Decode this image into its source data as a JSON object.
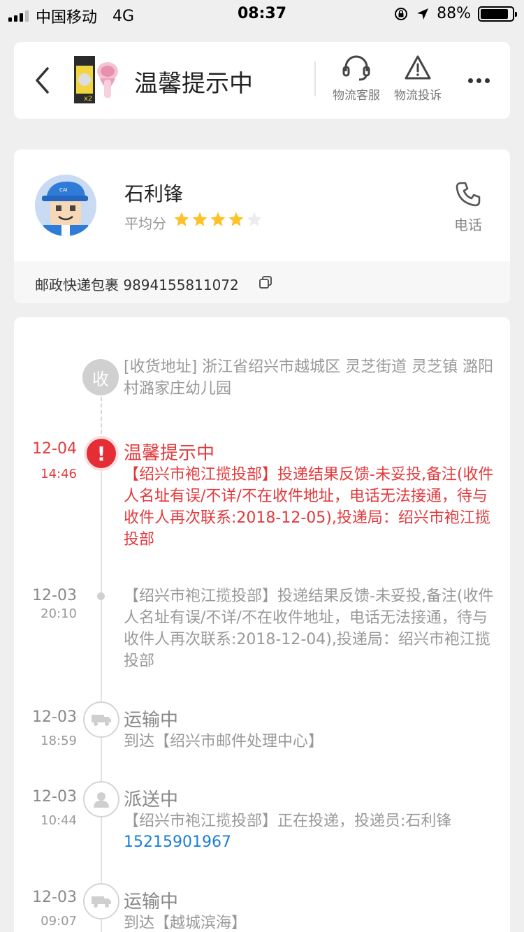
{
  "status_bar": {
    "carrier": "中国移动",
    "network": "4G",
    "time": "08:37",
    "battery": "88%"
  },
  "header": {
    "title": "温馨提示中",
    "service_label": "物流客服",
    "complaint_label": "物流投诉"
  },
  "courier": {
    "name": "石利锋",
    "rating_label": "平均分",
    "rating": 4,
    "rating_max": 5,
    "phone_label": "电话",
    "package_label": "邮政快递包裹 9894155811072"
  },
  "timeline": {
    "address": {
      "badge": "收",
      "text": "[收货地址] 浙江省绍兴市越城区  灵芝街道   灵芝镇 潞阳村潞家庄幼儿园"
    },
    "events": [
      {
        "date": "12-04",
        "time": "14:46",
        "title": "温馨提示中",
        "body": "【绍兴市袍江揽投部】投递结果反馈-未妥投,备注(收件人名址有误/不详/不在收件地址，电话无法接通，待与收件人再次联系:2018-12-05),投递局：绍兴市袍江揽投部"
      },
      {
        "date": "12-03",
        "time": "20:10",
        "body": "【绍兴市袍江揽投部】投递结果反馈-未妥投,备注(收件人名址有误/不详/不在收件地址，电话无法接通，待与收件人再次联系:2018-12-04),投递局：绍兴市袍江揽投部"
      },
      {
        "date": "12-03",
        "time": "18:59",
        "title": "运输中",
        "body": "到达【绍兴市邮件处理中心】"
      },
      {
        "date": "12-03",
        "time": "10:44",
        "title": "派送中",
        "body": "【绍兴市袍江揽投部】正在投递，投递员:石利锋",
        "phone": "15215901967"
      },
      {
        "date": "12-03",
        "time": "09:07",
        "title": "运输中",
        "body": "到达【越城滨海】"
      }
    ]
  }
}
